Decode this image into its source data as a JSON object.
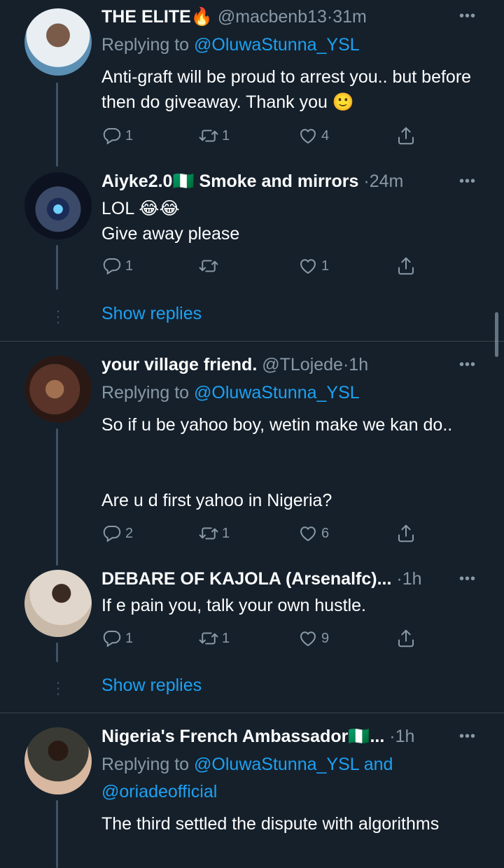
{
  "tweets": [
    {
      "name": "THE ELITE🔥",
      "handle": "@macbenb13",
      "time": "31m",
      "replying_label": "Replying to",
      "replying_to": "@OluwaStunna_YSL",
      "text": "Anti-graft will be proud to arrest you.. but before then do giveaway. Thank you 🙂",
      "replies": "1",
      "retweets": "1",
      "likes": "4"
    },
    {
      "name": "Aiyke2.0🇳🇬 Smoke and mirrors",
      "time": "24m",
      "text_line1": "LOL 😂😂",
      "text_line2": "Give away please",
      "replies": "1",
      "retweets": "",
      "likes": "1",
      "show_replies": "Show replies"
    },
    {
      "name": "your village friend.",
      "handle": "@TLojede",
      "time": "1h",
      "replying_label": "Replying to",
      "replying_to": "@OluwaStunna_YSL",
      "text_line1": "So if u be yahoo boy, wetin make we kan do..",
      "text_line2": "Are u d first yahoo in Nigeria?",
      "replies": "2",
      "retweets": "1",
      "likes": "6"
    },
    {
      "name": "DEBARE OF KAJOLA (Arsenalfc)...",
      "time": "1h",
      "text": "If e pain you, talk your own hustle.",
      "replies": "1",
      "retweets": "1",
      "likes": "9",
      "show_replies": "Show replies"
    },
    {
      "name": "Nigeria's French Ambassador🇳🇬...",
      "time": "1h",
      "replying_label": "Replying to",
      "replying_to": "@OluwaStunna_YSL",
      "replying_and": "and",
      "replying_to_2": "@oriadeofficial",
      "text": "The third settled the dispute with algorithms"
    }
  ],
  "separator": "·",
  "colors": {
    "background": "#15202b",
    "secondary_text": "#8899a6",
    "accent": "#1da1f2",
    "divider": "#38444d"
  },
  "icons": [
    "reply-icon",
    "retweet-icon",
    "like-icon",
    "share-icon",
    "more-icon"
  ]
}
